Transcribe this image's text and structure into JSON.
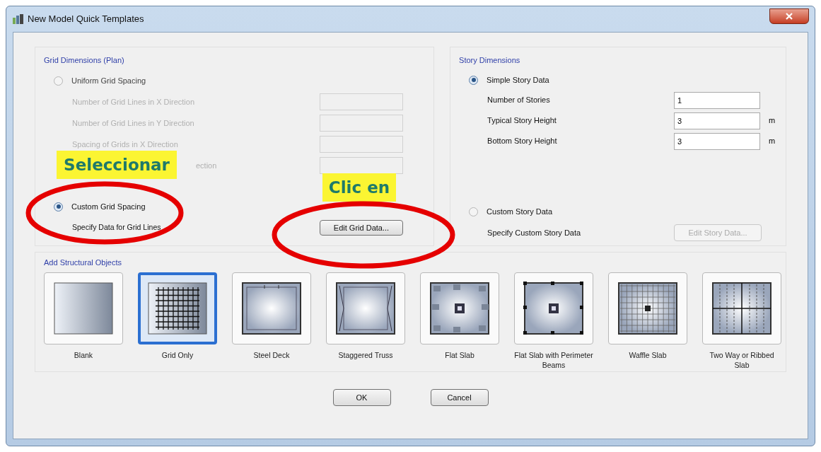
{
  "window": {
    "title": "New Model Quick Templates"
  },
  "grid_dimensions": {
    "title": "Grid Dimensions (Plan)",
    "uniform": {
      "label": "Uniform Grid Spacing",
      "selected": false,
      "fields": [
        {
          "label": "Number of Grid Lines in X Direction",
          "kind": "full"
        },
        {
          "label": "Number of Grid Lines in Y Direction",
          "kind": "full"
        },
        {
          "label": "Spacing of Grids in X Direction",
          "kind": "full"
        },
        {
          "label": "ection",
          "kind": "covered"
        }
      ]
    },
    "custom": {
      "label": "Custom Grid Spacing",
      "selected": true,
      "sub_label": "Specify Data for Grid Lines",
      "button": "Edit Grid Data..."
    }
  },
  "story_dimensions": {
    "title": "Story Dimensions",
    "simple": {
      "label": "Simple Story Data",
      "selected": true,
      "fields": [
        {
          "label": "Number of Stories",
          "value": "1"
        },
        {
          "label": "Typical Story Height",
          "value": "3",
          "unit": "m"
        },
        {
          "label": "Bottom Story Height",
          "value": "3",
          "unit": "m"
        }
      ]
    },
    "custom": {
      "label": "Custom Story Data",
      "selected": false,
      "sub_label": "Specify Custom Story Data",
      "button": "Edit Story Data..."
    }
  },
  "structural_objects": {
    "title": "Add Structural Objects",
    "items": [
      {
        "label": "Blank",
        "kind": "blank",
        "selected": false
      },
      {
        "label": "Grid Only",
        "kind": "grid",
        "selected": true
      },
      {
        "label": "Steel Deck",
        "kind": "deck",
        "selected": false
      },
      {
        "label": "Staggered Truss",
        "kind": "truss",
        "selected": false
      },
      {
        "label": "Flat Slab",
        "kind": "flat",
        "selected": false
      },
      {
        "label": "Flat Slab with Perimeter Beams",
        "kind": "perimeter",
        "selected": false
      },
      {
        "label": "Waffle Slab",
        "kind": "waffle",
        "selected": false
      },
      {
        "label": "Two Way or Ribbed Slab",
        "kind": "ribbed",
        "selected": false
      }
    ]
  },
  "buttons": [
    "OK",
    "Cancel"
  ],
  "annotations": [
    {
      "text": "Seleccionar",
      "kind": "select"
    },
    {
      "text": "Clic en",
      "kind": "click"
    }
  ]
}
